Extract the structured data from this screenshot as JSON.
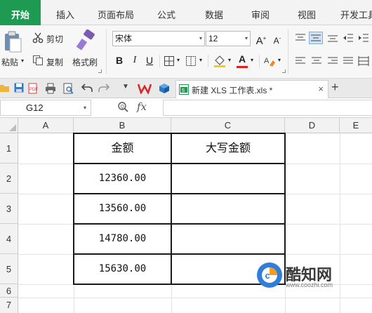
{
  "ribbon_tabs": [
    "开始",
    "插入",
    "页面布局",
    "公式",
    "数据",
    "审阅",
    "视图",
    "开发工具"
  ],
  "clipboard": {
    "paste": "粘贴",
    "cut": "剪切",
    "copy": "复制",
    "format_painter": "格式刷"
  },
  "font": {
    "name": "宋体",
    "size": "12"
  },
  "format_buttons": {
    "bold": "B",
    "italic": "I",
    "underline": "U",
    "font_color": "A"
  },
  "doc_tab": {
    "title": "新建 XLS 工作表.xls *",
    "close": "×",
    "add": "+"
  },
  "formula_bar": {
    "name_box": "G12",
    "fx": "fx",
    "value": ""
  },
  "columns": [
    "A",
    "B",
    "C",
    "D",
    "E"
  ],
  "rows": [
    "1",
    "2",
    "3",
    "4",
    "5",
    "6",
    "7"
  ],
  "table": {
    "header": [
      "金额",
      "大写金额"
    ],
    "amounts": [
      "12360.00",
      "13560.00",
      "14780.00",
      "15630.00"
    ],
    "uppercase": [
      "",
      "",
      "",
      ""
    ]
  },
  "watermark": {
    "name": "酷知网",
    "url": "www.coozhi.com"
  },
  "colors": {
    "accent": "#1e9a52",
    "doc_tab_icon": "#1e9a52"
  }
}
